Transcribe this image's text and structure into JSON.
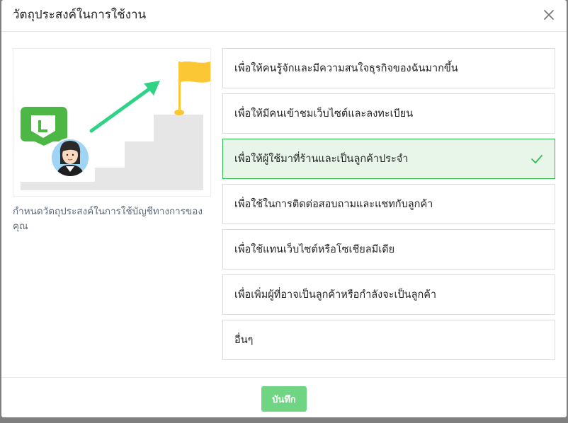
{
  "dialog": {
    "title": "วัตถุประสงค์ในการใช้งาน",
    "close_icon": "close-icon"
  },
  "intro": {
    "caption": "กำหนดวัตถุประสงค์ในการใช้บัญชีทางการของคุณ",
    "illustration_icons": [
      "line-logo-icon",
      "avatar",
      "arrow-up-right-icon",
      "flag-icon",
      "stairs-graphic"
    ]
  },
  "options": [
    {
      "label": "เพื่อให้คนรู้จักและมีความสนใจธุรกิจของฉันมากขึ้น",
      "selected": false
    },
    {
      "label": "เพื่อให้มีคนเข้าชมเว็บไซต์และลงทะเบียน",
      "selected": false
    },
    {
      "label": "เพื่อให้ผู้ใช้มาที่ร้านและเป็นลูกค้าประจำ",
      "selected": true
    },
    {
      "label": "เพื่อใช้ในการติดต่อสอบถามและแชทกับลูกค้า",
      "selected": false
    },
    {
      "label": "เพื่อใช้แทนเว็บไซต์หรือโซเชียลมีเดีย",
      "selected": false
    },
    {
      "label": "เพื่อเพิ่มผู้ที่อาจเป็นลูกค้าหรือกำลังจะเป็นลูกค้า",
      "selected": false
    },
    {
      "label": "อื่นๆ",
      "selected": false
    }
  ],
  "footer": {
    "save_label": "บันทึก"
  },
  "colors": {
    "accent": "#06c755",
    "selected_bg": "#e8f6e9",
    "selected_border": "#2ebd4f",
    "save_button": "#6fd582",
    "flag": "#fbc735",
    "arrow": "#2ed386",
    "line_green": "#4cb744"
  }
}
